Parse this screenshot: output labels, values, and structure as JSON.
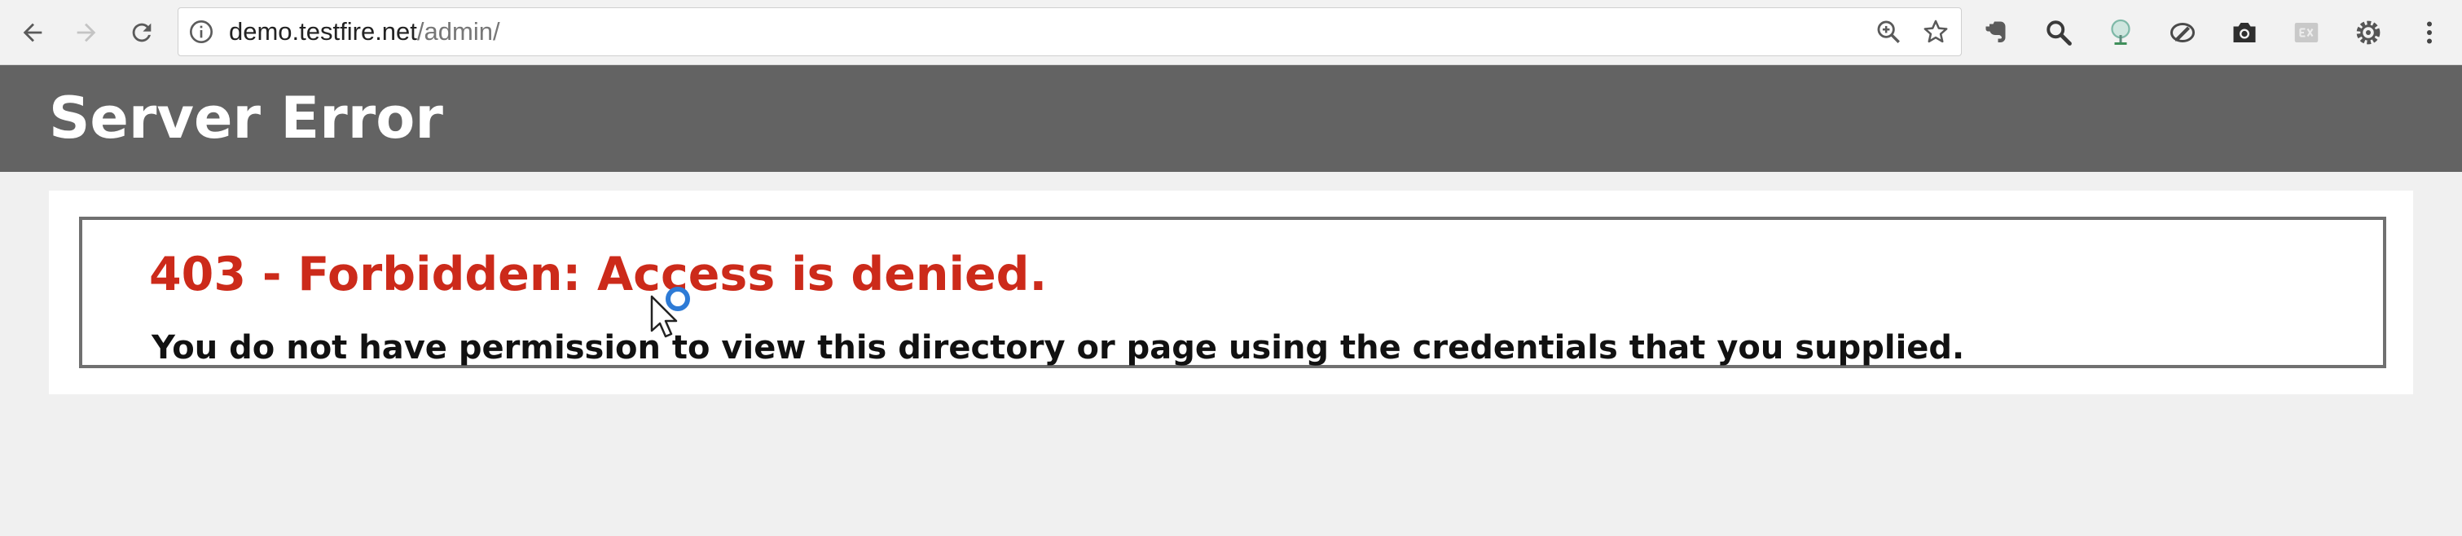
{
  "browser": {
    "url_host": "demo.testfire.net",
    "url_path": "/admin/",
    "icons": {
      "back": "back-arrow-icon",
      "forward": "forward-arrow-icon",
      "reload": "reload-icon",
      "site_info": "info-icon",
      "zoom": "zoom-icon",
      "bookmark": "star-icon",
      "menu": "kebab-menu-icon"
    },
    "extensions": [
      "evernote-icon",
      "search-icon",
      "tree-icon",
      "pen-icon",
      "camera-icon",
      "ex-icon",
      "gear-icon"
    ]
  },
  "page": {
    "header_title": "Server Error",
    "error_title": "403 - Forbidden: Access is denied.",
    "error_message": "You do not have permission to view this directory or page using the credentials that you supplied."
  },
  "colors": {
    "header_bg": "#636363",
    "error_title": "#cc2a1a",
    "page_bg": "#f0f0f0"
  }
}
